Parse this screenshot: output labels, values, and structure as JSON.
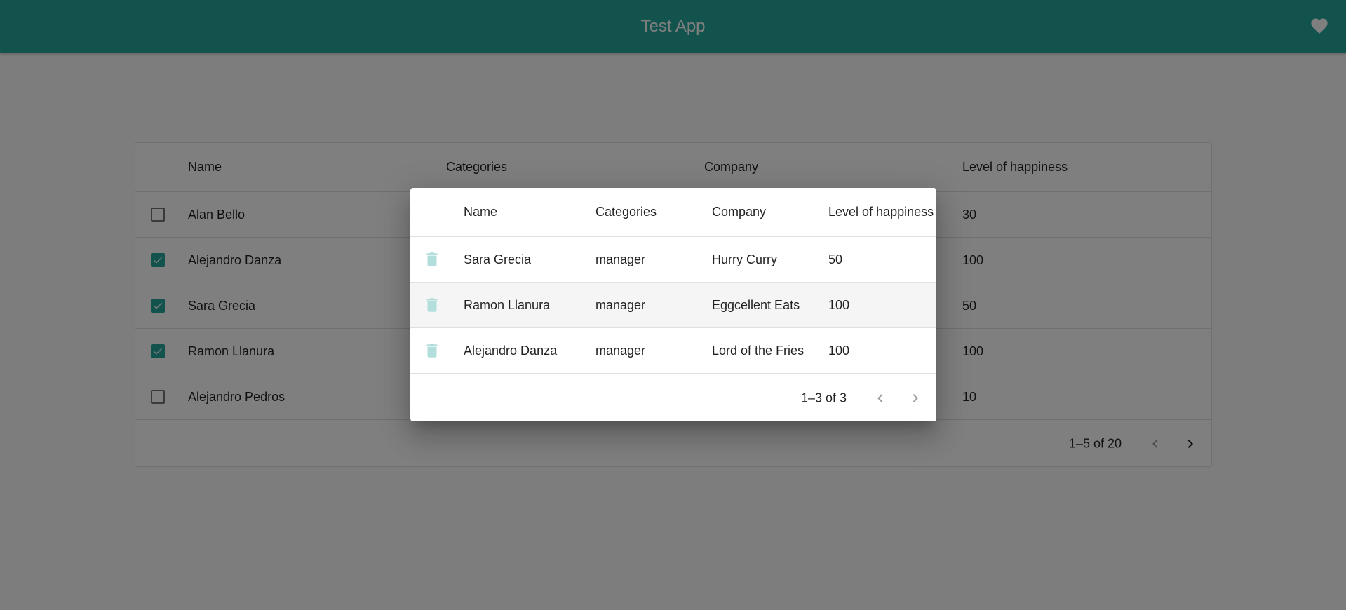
{
  "app": {
    "title": "Test App",
    "heart_icon": "heart-icon",
    "accent_color": "#26a69a"
  },
  "main_table": {
    "columns": [
      "Name",
      "Categories",
      "Company",
      "Level of happiness"
    ],
    "rows": [
      {
        "name": "Alan Bello",
        "happiness": "30",
        "checked": false
      },
      {
        "name": "Alejandro Danza",
        "happiness": "100",
        "checked": true
      },
      {
        "name": "Sara Grecia",
        "happiness": "50",
        "checked": true
      },
      {
        "name": "Ramon Llanura",
        "happiness": "100",
        "checked": true
      },
      {
        "name": "Alejandro Pedros",
        "happiness": "10",
        "checked": false
      }
    ],
    "pagination": {
      "range": "1–5 of 20",
      "prev_icon": "chevron-left-icon",
      "next_icon": "chevron-right-icon"
    }
  },
  "dialog": {
    "columns": [
      "Name",
      "Categories",
      "Company",
      "Level of happiness"
    ],
    "rows": [
      {
        "name": "Sara Grecia",
        "category": "manager",
        "company": "Hurry Curry",
        "happiness": "50"
      },
      {
        "name": "Ramon Llanura",
        "category": "manager",
        "company": "Eggcellent Eats",
        "happiness": "100"
      },
      {
        "name": "Alejandro Danza",
        "category": "manager",
        "company": "Lord of the Fries",
        "happiness": "100"
      }
    ],
    "row_icon": "trash-icon",
    "pagination": {
      "range": "1–3 of 3",
      "prev_icon": "chevron-left-icon",
      "next_icon": "chevron-right-icon"
    }
  }
}
